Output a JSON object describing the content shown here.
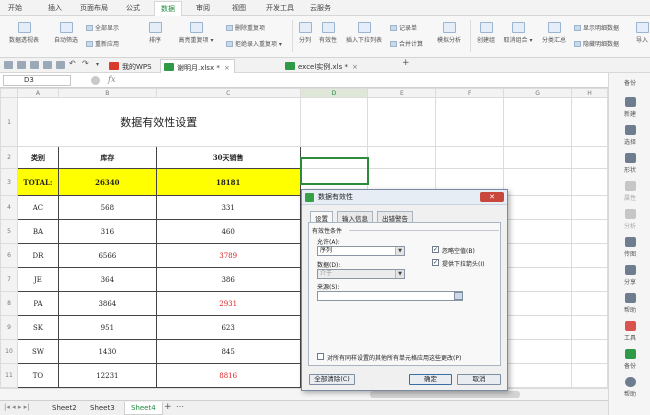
{
  "menu": {
    "tabs": [
      "开始",
      "插入",
      "页面布局",
      "公式",
      "数据",
      "审阅",
      "视图",
      "开发工具",
      "云服务"
    ],
    "active": "数据"
  },
  "ribbon": {
    "groups": [
      {
        "label": "数据透视表"
      },
      {
        "label": "自动筛选"
      },
      {
        "label": "排序"
      },
      {
        "label": "高亮重复项 ▾"
      },
      {
        "label": "分列"
      },
      {
        "label": "有效性"
      },
      {
        "label": "插入下拉列表"
      },
      {
        "label": "合并计算"
      },
      {
        "label": "模拟分析"
      },
      {
        "label": "创建组"
      },
      {
        "label": "取消组合 ▾"
      },
      {
        "label": "分类汇总"
      },
      {
        "label": "导入"
      }
    ],
    "small": [
      "全部显示",
      "重新应用",
      "删除重复项",
      "拒绝录入重复项 ▾",
      "记录单",
      "显示明细数据",
      "隐藏明细数据"
    ]
  },
  "doc_tabs": [
    {
      "label": "我的WPS"
    },
    {
      "label": "谢明月.xlsx *"
    },
    {
      "label": "excel实例.xls *"
    }
  ],
  "formula": {
    "cell_ref": "D3",
    "fx": "fx"
  },
  "sheet": {
    "columns": [
      "A",
      "B",
      "C",
      "D",
      "E",
      "F",
      "G",
      "H"
    ],
    "title": "数据有效性设置",
    "headers": [
      "类别",
      "库存",
      "30天销售"
    ],
    "total": [
      "TOTAL:",
      "26340",
      "18181"
    ],
    "rows": [
      {
        "n": "4",
        "cat": "AC",
        "stock": "568",
        "sales": "331",
        "red": false
      },
      {
        "n": "5",
        "cat": "BA",
        "stock": "316",
        "sales": "460",
        "red": false
      },
      {
        "n": "6",
        "cat": "DR",
        "stock": "6566",
        "sales": "3789",
        "red": true
      },
      {
        "n": "7",
        "cat": "JE",
        "stock": "364",
        "sales": "386",
        "red": false
      },
      {
        "n": "8",
        "cat": "PA",
        "stock": "3864",
        "sales": "2931",
        "red": true
      },
      {
        "n": "9",
        "cat": "SK",
        "stock": "951",
        "sales": "623",
        "red": false
      },
      {
        "n": "10",
        "cat": "SW",
        "stock": "1430",
        "sales": "845",
        "red": false
      },
      {
        "n": "11",
        "cat": "TO",
        "stock": "12231",
        "sales": "8816",
        "red": true
      }
    ],
    "row_nums": [
      "1",
      "2",
      "3",
      "12",
      "13"
    ]
  },
  "sheet_tabs": [
    "Sheet2",
    "Sheet3",
    "Sheet4"
  ],
  "active_sheet": "Sheet4",
  "right_panel": [
    "备份",
    "新建",
    "选择",
    "形状",
    "属性",
    "分析",
    "传图",
    "分享",
    "帮助",
    "工具",
    "备份",
    "帮助"
  ],
  "dialog": {
    "title": "数据有效性",
    "tabs": [
      "设置",
      "输入信息",
      "出错警告"
    ],
    "section": "有效性条件",
    "allow_label": "允许(A):",
    "allow_value": "序列",
    "data_label": "数据(D):",
    "data_value": "介于",
    "ignore_blank": "忽略空值(B)",
    "dropdown": "提供下拉箭头(I)",
    "source_label": "来源(S):",
    "source_value": "",
    "apply_all": "对所有同样设置的其他所有单元格应用这些更改(P)",
    "clear_btn": "全部清除(C)",
    "ok_btn": "确定",
    "cancel_btn": "取消"
  }
}
